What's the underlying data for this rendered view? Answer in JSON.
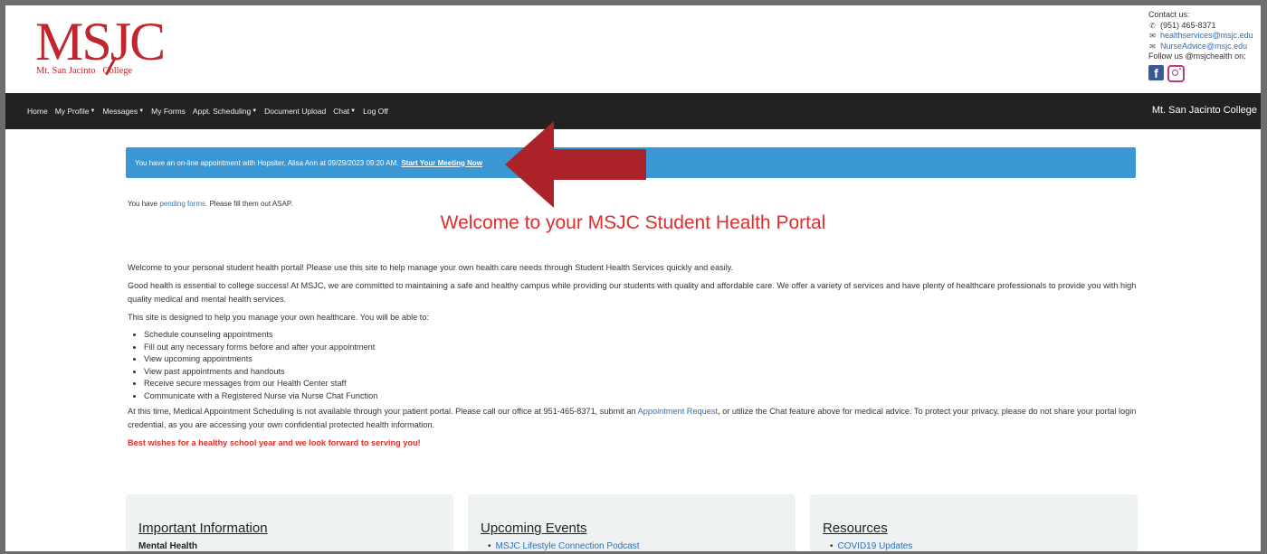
{
  "logo": {
    "main": "MSJC",
    "left": "Mt. San Jacinto",
    "right": "College"
  },
  "contact": {
    "label": "Contact us:",
    "phone": "(951) 465-8371",
    "email1": "healthservices@msjc.edu",
    "email2": "NurseAdvice@msjc.edu",
    "follow": "Follow us @msjchealth on:"
  },
  "nav": {
    "items": [
      {
        "label": "Home",
        "dropdown": false
      },
      {
        "label": "My Profile",
        "dropdown": true
      },
      {
        "label": "Messages",
        "dropdown": true
      },
      {
        "label": "My Forms",
        "dropdown": false
      },
      {
        "label": "Appt. Scheduling",
        "dropdown": true
      },
      {
        "label": "Document Upload",
        "dropdown": false
      },
      {
        "label": "Chat",
        "dropdown": true
      },
      {
        "label": "Log Off",
        "dropdown": false
      }
    ],
    "right": "Mt. San Jacinto College"
  },
  "alert": {
    "text": "You have an on-line appointment with Hopsiter, Alisa Ann at 09/29/2023 09:20 AM.",
    "link": "Start Your Meeting Now"
  },
  "pending": {
    "before": "You have",
    "link": "pending forms",
    "after": ". Please fill them out ASAP."
  },
  "welcome": "Welcome to your MSJC Student Health Portal",
  "body": {
    "p1": "Welcome to your personal student health portal! Please use this site to help manage your own health care needs through Student Health Services quickly and easily.",
    "p2": "Good health is essential to college success! At MSJC, we are committed to maintaining a safe and healthy campus while providing our students with quality and affordable care. We offer a variety of services and have plenty of healthcare professionals to provide you with high quality medical and mental health services.",
    "p3": "This site is designed to help you manage your own healthcare. You will be able to:",
    "list": [
      "Schedule counseling appointments",
      "Fill out any necessary forms before and after your appointment",
      "View upcoming appointments",
      "View past appointments and handouts",
      "Receive secure messages from our Health Center staff",
      "Communicate with a Registered Nurse via Nurse Chat Function"
    ],
    "p4_before": "At this time, Medical Appointment Scheduling is not available through your patient portal. Please call our office at 951-465-8371, submit an",
    "p4_link": "Appointment Request",
    "p4_after": ", or utilize the Chat feature above for medical advice. To protect your privacy, please do not share your portal login credential, as you are accessing your own confidential protected health information.",
    "best": "Best wishes for a healthy school year and we look forward to serving you!"
  },
  "panels": {
    "important": {
      "title": "Important Information",
      "sub": "Mental Health"
    },
    "events": {
      "title": "Upcoming Events",
      "link": "MSJC Lifestyle Connection Podcast"
    },
    "resources": {
      "title": "Resources",
      "link": "COVID19 Updates"
    }
  },
  "colors": {
    "brand": "#c0262d",
    "alert": "#3b97d3",
    "nav": "#222222",
    "welcome": "#e32d2d"
  }
}
